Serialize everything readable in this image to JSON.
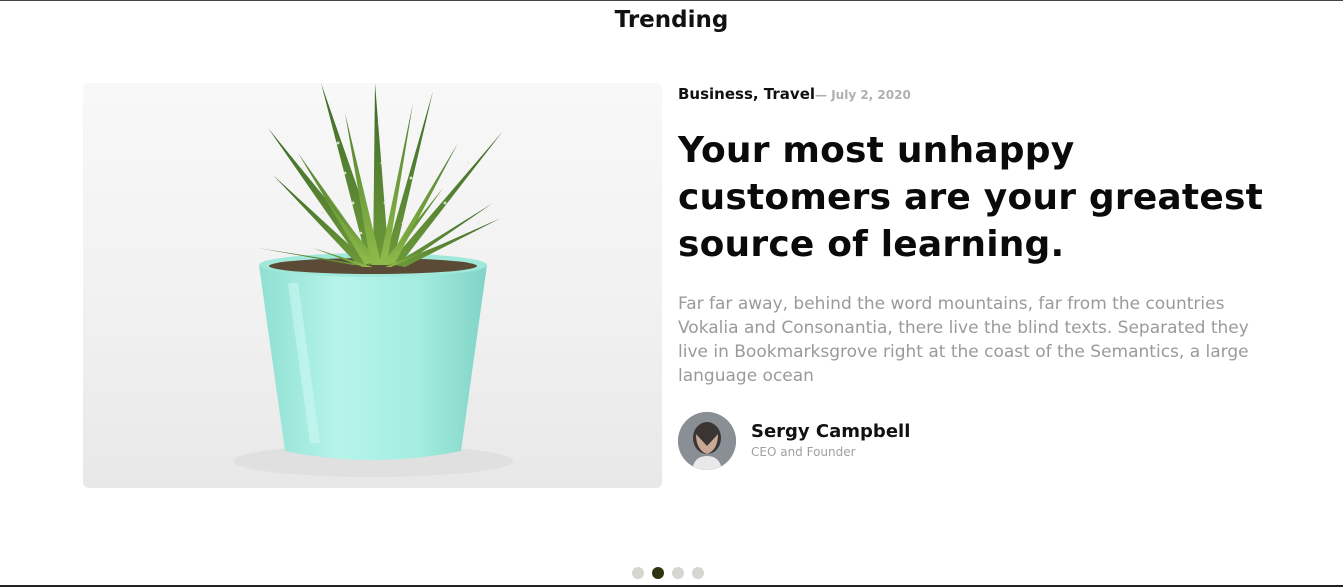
{
  "section": {
    "title": "Trending"
  },
  "post": {
    "categories": "Business, Travel",
    "date": "— July 2, 2020",
    "headline": "Your most unhappy customers are your greatest source of learning.",
    "excerpt": "Far far away, behind the word mountains, far from the countries Vokalia and Consonantia, there live the blind texts. Separated they live in Bookmarksgrove right at the coast of the Semantics, a large language ocean",
    "image": "succulent-plant-in-mint-pot"
  },
  "author": {
    "name": "Sergy Campbell",
    "role": "CEO and Founder"
  },
  "carousel": {
    "slide_count": 4,
    "active_index": 1
  },
  "colors": {
    "accent": "#2f3310",
    "dot_inactive": "#d6d6d0",
    "pot": "#a8efe2",
    "muted_text": "#9a9a9a"
  }
}
